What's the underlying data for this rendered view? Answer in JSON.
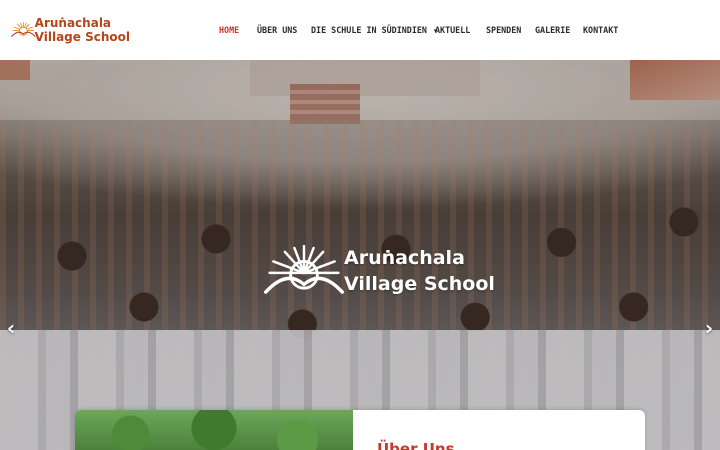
{
  "header": {
    "logo": {
      "line1": "Aruṅachala",
      "line2": "Village School",
      "icon": "sun-hill-logo-icon"
    },
    "nav": [
      {
        "label": "Home",
        "active": true
      },
      {
        "label": "Über uns",
        "active": false
      },
      {
        "label": "Die Schule in Südindien",
        "active": false,
        "has_dropdown": true
      },
      {
        "label": "Aktuell",
        "active": false
      },
      {
        "label": "Spenden",
        "active": false
      },
      {
        "label": "Galerie",
        "active": false
      },
      {
        "label": "Kontakt",
        "active": false
      }
    ]
  },
  "hero": {
    "logo": {
      "line1": "Aruṅachala",
      "line2": "Village School",
      "icon": "sun-hill-logo-icon"
    },
    "prev_icon": "chevron-left-icon",
    "next_icon": "chevron-right-icon"
  },
  "card": {
    "title": "Über Uns"
  },
  "colors": {
    "brand": "#b5451b",
    "active_nav": "#c0392b",
    "nav_text": "#2b2b2b"
  }
}
